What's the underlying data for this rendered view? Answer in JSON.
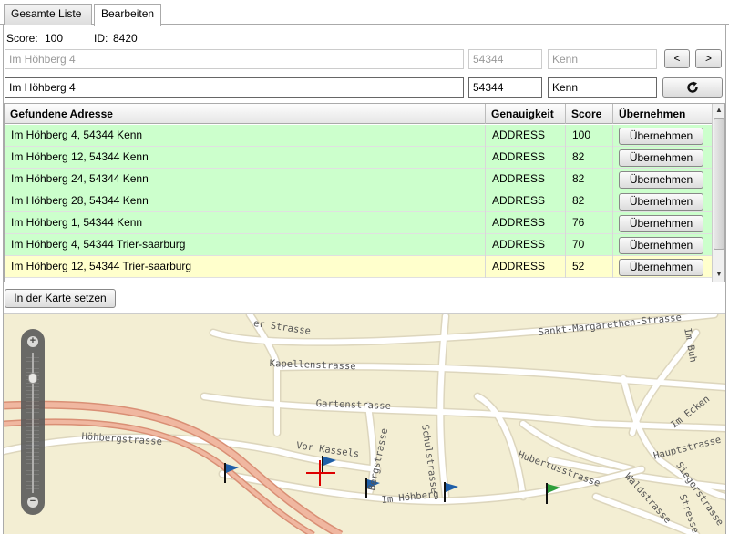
{
  "tabs": [
    {
      "label": "Gesamte Liste"
    },
    {
      "label": "Bearbeiten"
    }
  ],
  "meta": {
    "score_label": "Score:",
    "score_value": "100",
    "id_label": "ID:",
    "id_value": "8420"
  },
  "original": {
    "street": "Im Höhberg 4",
    "zip": "54344",
    "city": "Kenn"
  },
  "nav": {
    "prev": "<",
    "next": ">"
  },
  "edit": {
    "street": "Im Höhberg 4",
    "zip": "54344",
    "city": "Kenn",
    "refresh_icon": "refresh-icon"
  },
  "grid": {
    "headers": [
      "Gefundene Adresse",
      "Genauigkeit",
      "Score",
      "Übernehmen"
    ],
    "rows": [
      {
        "address": "Im Höhberg 4, 54344 Kenn",
        "accuracy": "ADDRESS",
        "score": "100",
        "action": "Übernehmen"
      },
      {
        "address": "Im Höhberg 12, 54344 Kenn",
        "accuracy": "ADDRESS",
        "score": "82",
        "action": "Übernehmen"
      },
      {
        "address": "Im Höhberg 24, 54344 Kenn",
        "accuracy": "ADDRESS",
        "score": "82",
        "action": "Übernehmen"
      },
      {
        "address": "Im Höhberg 28, 54344 Kenn",
        "accuracy": "ADDRESS",
        "score": "82",
        "action": "Übernehmen"
      },
      {
        "address": "Im Höhberg 1, 54344 Kenn",
        "accuracy": "ADDRESS",
        "score": "76",
        "action": "Übernehmen"
      },
      {
        "address": "Im Höhberg 4, 54344 Trier-saarburg",
        "accuracy": "ADDRESS",
        "score": "70",
        "action": "Übernehmen"
      },
      {
        "address": "Im Höhberg 12, 54344 Trier-saarburg",
        "accuracy": "ADDRESS",
        "score": "52",
        "action": "Übernehmen"
      }
    ],
    "colors": {
      "green": "#ccffcc",
      "yellow": "#ffffcc"
    }
  },
  "set_on_map": "In der Karte setzen",
  "map": {
    "streets": [
      "er Strasse",
      "Sankt-Margarethen-Strasse",
      "Im Buh",
      "Kapellenstrasse",
      "Gartenstrasse",
      "Im Ecken",
      "Höhbergstrasse",
      "Vor Kassels",
      "Bergstrasse",
      "Schulstrasse",
      "Hubertusstrasse",
      "Hauptstrasse",
      "Siegerstrasse",
      "Waldstrasse",
      "Im Höhberg",
      "Stresse"
    ],
    "colors": {
      "background": "#f3eed3",
      "road": "#ffffff",
      "highway": "#e8a890",
      "flag_blue": "#1f5fa8",
      "flag_green": "#2e9e3a",
      "crosshair": "#dd0000"
    }
  }
}
